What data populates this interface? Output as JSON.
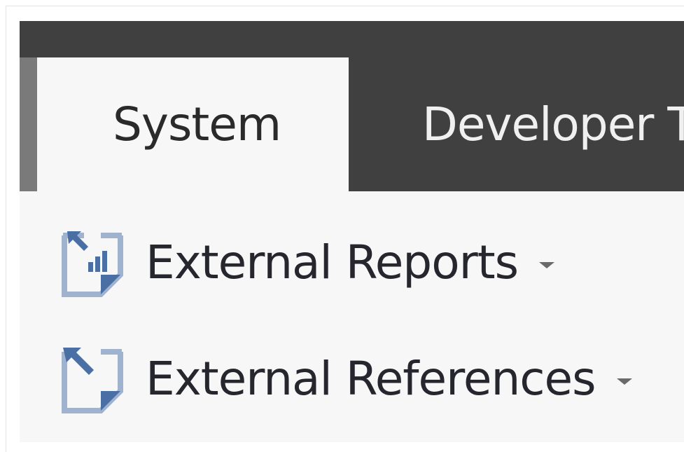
{
  "ribbon": {
    "tabs": [
      {
        "label": "System",
        "active": true
      },
      {
        "label": "Developer T",
        "active": false
      }
    ],
    "commands": [
      {
        "label": "External Reports",
        "icon": "external-reports-icon",
        "has_dropdown": true
      },
      {
        "label": "External References",
        "icon": "external-references-icon",
        "has_dropdown": true
      }
    ]
  },
  "colors": {
    "ribbon_dark": "#404040",
    "tab_active_bg": "#f7f7f7",
    "icon_blue": "#4a6fa5"
  }
}
